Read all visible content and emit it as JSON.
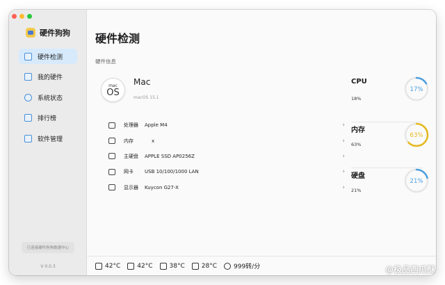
{
  "app": {
    "name": "硬件狗狗",
    "version": "V 0.0.3",
    "status_text": "已连接硬件狗狗数据中心"
  },
  "sidebar": {
    "items": [
      {
        "label": "硬件检测",
        "icon": "hardware-check-icon",
        "active": true
      },
      {
        "label": "我的硬件",
        "icon": "my-hardware-icon"
      },
      {
        "label": "系统状态",
        "icon": "system-status-icon"
      },
      {
        "label": "排行榜",
        "icon": "ranking-icon"
      },
      {
        "label": "软件管理",
        "icon": "software-manage-icon"
      }
    ]
  },
  "main": {
    "title": "硬件检测",
    "section_label": "硬件信息",
    "device": {
      "name": "Mac",
      "os_badge_small": "mac",
      "os_badge_big": "OS",
      "os_version": "macOS 15.1"
    },
    "specs": [
      {
        "label": "处理器",
        "value": "Apple M4",
        "icon": "cpu-icon"
      },
      {
        "label": "内存",
        "value": "x",
        "icon": "memory-icon"
      },
      {
        "label": "主硬盘",
        "value": "APPLE SSD AP0256Z",
        "icon": "disk-icon"
      },
      {
        "label": "网卡",
        "value": "USB 10/100/1000 LAN",
        "icon": "network-icon"
      },
      {
        "label": "显示器",
        "value": "Kuycon G27-X",
        "icon": "display-icon"
      }
    ],
    "usage": [
      {
        "name": "CPU",
        "percent_text": "18%",
        "ring_text": "17%",
        "value": 0.17,
        "color": "#4a9fe0"
      },
      {
        "name": "内存",
        "percent_text": "63%",
        "ring_text": "63%",
        "value": 0.63,
        "color": "#e6b91e"
      },
      {
        "name": "硬盘",
        "percent_text": "21%",
        "ring_text": "21%",
        "value": 0.21,
        "color": "#4a9fe0"
      }
    ]
  },
  "status_bar": [
    {
      "value": "42°C",
      "icon": "cpu-temp-icon"
    },
    {
      "value": "42°C",
      "icon": "gpu-temp-icon"
    },
    {
      "value": "38°C",
      "icon": "ssd-temp-icon"
    },
    {
      "value": "28°C",
      "icon": "board-temp-icon"
    },
    {
      "value": "999转/分",
      "icon": "fan-icon"
    }
  ],
  "watermark": "@极品西瓜酥"
}
